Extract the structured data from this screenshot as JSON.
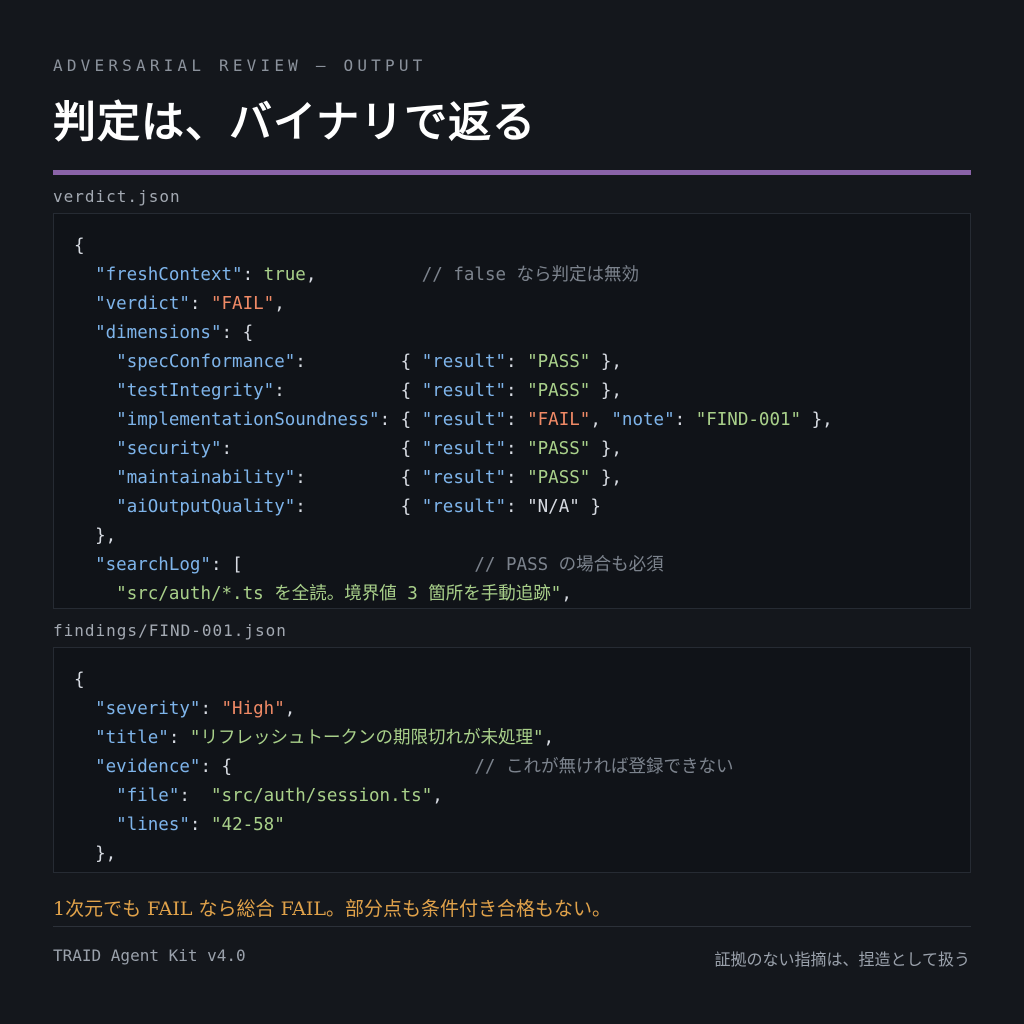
{
  "header": {
    "eyebrow": "ADVERSARIAL REVIEW — OUTPUT",
    "title": "判定は、バイナリで返る"
  },
  "files": [
    {
      "name": "verdict.json",
      "lines": [
        [
          [
            "p",
            "{"
          ]
        ],
        [
          [
            "p",
            "  "
          ],
          [
            "k",
            "\"freshContext\""
          ],
          [
            "p",
            ": "
          ],
          [
            "b",
            "true"
          ],
          [
            "p",
            ",          "
          ],
          [
            "c",
            "// false なら判定は無効"
          ]
        ],
        [
          [
            "p",
            "  "
          ],
          [
            "k",
            "\"verdict\""
          ],
          [
            "p",
            ": "
          ],
          [
            "fail",
            "\"FAIL\""
          ],
          [
            "p",
            ","
          ]
        ],
        [
          [
            "p",
            "  "
          ],
          [
            "k",
            "\"dimensions\""
          ],
          [
            "p",
            ": {"
          ]
        ],
        [
          [
            "p",
            "    "
          ],
          [
            "k",
            "\"specConformance\""
          ],
          [
            "p",
            ":         { "
          ],
          [
            "k",
            "\"result\""
          ],
          [
            "p",
            ": "
          ],
          [
            "s",
            "\"PASS\""
          ],
          [
            "p",
            " },"
          ]
        ],
        [
          [
            "p",
            "    "
          ],
          [
            "k",
            "\"testIntegrity\""
          ],
          [
            "p",
            ":           { "
          ],
          [
            "k",
            "\"result\""
          ],
          [
            "p",
            ": "
          ],
          [
            "s",
            "\"PASS\""
          ],
          [
            "p",
            " },"
          ]
        ],
        [
          [
            "p",
            "    "
          ],
          [
            "k",
            "\"implementationSoundness\""
          ],
          [
            "p",
            ": { "
          ],
          [
            "k",
            "\"result\""
          ],
          [
            "p",
            ": "
          ],
          [
            "fail",
            "\"FAIL\""
          ],
          [
            "p",
            ", "
          ],
          [
            "k",
            "\"note\""
          ],
          [
            "p",
            ": "
          ],
          [
            "s",
            "\"FIND-001\""
          ],
          [
            "p",
            " },"
          ]
        ],
        [
          [
            "p",
            "    "
          ],
          [
            "k",
            "\"security\""
          ],
          [
            "p",
            ":                { "
          ],
          [
            "k",
            "\"result\""
          ],
          [
            "p",
            ": "
          ],
          [
            "s",
            "\"PASS\""
          ],
          [
            "p",
            " },"
          ]
        ],
        [
          [
            "p",
            "    "
          ],
          [
            "k",
            "\"maintainability\""
          ],
          [
            "p",
            ":         { "
          ],
          [
            "k",
            "\"result\""
          ],
          [
            "p",
            ": "
          ],
          [
            "s",
            "\"PASS\""
          ],
          [
            "p",
            " },"
          ]
        ],
        [
          [
            "p",
            "    "
          ],
          [
            "k",
            "\"aiOutputQuality\""
          ],
          [
            "p",
            ":         { "
          ],
          [
            "k",
            "\"result\""
          ],
          [
            "p",
            ": "
          ],
          [
            "na",
            "\"N/A\""
          ],
          [
            "p",
            " }"
          ]
        ],
        [
          [
            "p",
            "  },"
          ]
        ],
        [
          [
            "p",
            "  "
          ],
          [
            "k",
            "\"searchLog\""
          ],
          [
            "p",
            ": [                      "
          ],
          [
            "c",
            "// PASS の場合も必須"
          ]
        ],
        [
          [
            "p",
            "    "
          ],
          [
            "s",
            "\"src/auth/*.ts を全読。境界値 3 箇所を手動追跡\""
          ],
          [
            "p",
            ","
          ]
        ]
      ]
    },
    {
      "name": "findings/FIND-001.json",
      "lines": [
        [
          [
            "p",
            "{"
          ]
        ],
        [
          [
            "p",
            "  "
          ],
          [
            "k",
            "\"severity\""
          ],
          [
            "p",
            ": "
          ],
          [
            "fail",
            "\"High\""
          ],
          [
            "p",
            ","
          ]
        ],
        [
          [
            "p",
            "  "
          ],
          [
            "k",
            "\"title\""
          ],
          [
            "p",
            ": "
          ],
          [
            "s",
            "\"リフレッシュトークンの期限切れが未処理\""
          ],
          [
            "p",
            ","
          ]
        ],
        [
          [
            "p",
            "  "
          ],
          [
            "k",
            "\"evidence\""
          ],
          [
            "p",
            ": {                       "
          ],
          [
            "c",
            "// これが無ければ登録できない"
          ]
        ],
        [
          [
            "p",
            "    "
          ],
          [
            "k",
            "\"file\""
          ],
          [
            "p",
            ":  "
          ],
          [
            "s",
            "\"src/auth/session.ts\""
          ],
          [
            "p",
            ","
          ]
        ],
        [
          [
            "p",
            "    "
          ],
          [
            "k",
            "\"lines\""
          ],
          [
            "p",
            ": "
          ],
          [
            "s",
            "\"42-58\""
          ]
        ],
        [
          [
            "p",
            "  },"
          ]
        ]
      ]
    }
  ],
  "note": "1次元でも FAIL なら総合 FAIL。部分点も条件付き合格もない。",
  "footer": {
    "left": "TRAID Agent Kit v4.0",
    "right": "証拠のない指摘は、捏造として扱う"
  }
}
